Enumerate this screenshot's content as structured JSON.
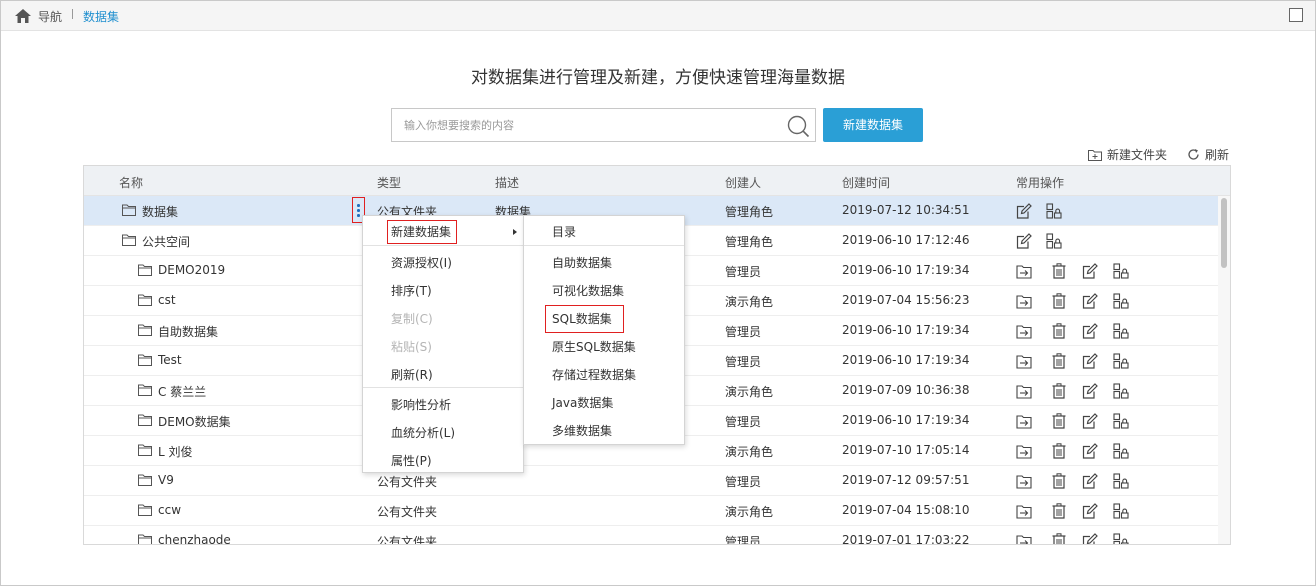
{
  "breadcrumb": {
    "home_label": "导航",
    "current": "数据集"
  },
  "headline": "对数据集进行管理及新建，方便快速管理海量数据",
  "search": {
    "placeholder": "输入你想要搜索的内容",
    "value": ""
  },
  "new_dataset_button": "新建数据集",
  "toolbar": {
    "new_folder": "新建文件夹",
    "refresh": "刷新"
  },
  "columns": [
    "名称",
    "类型",
    "描述",
    "创建人",
    "创建时间",
    "常用操作"
  ],
  "rows": [
    {
      "name": "数据集",
      "type": "公有文件夹",
      "desc": "数据集",
      "creator": "管理角色",
      "time": "2019-07-12 10:34:51",
      "level": 0,
      "selected": true
    },
    {
      "name": "公共空间",
      "type": "",
      "desc": "",
      "creator": "管理角色",
      "time": "2019-06-10 17:12:46",
      "level": 0
    },
    {
      "name": "DEMO2019",
      "type": "",
      "desc": "",
      "creator": "管理员",
      "time": "2019-06-10 17:19:34",
      "level": 1
    },
    {
      "name": "cst",
      "type": "",
      "desc": "",
      "creator": "演示角色",
      "time": "2019-07-04 15:56:23",
      "level": 1
    },
    {
      "name": "自助数据集",
      "type": "",
      "desc": "",
      "creator": "管理员",
      "time": "2019-06-10 17:19:34",
      "level": 1
    },
    {
      "name": "Test",
      "type": "",
      "desc": "",
      "creator": "管理员",
      "time": "2019-06-10 17:19:34",
      "level": 1
    },
    {
      "name": "C 蔡兰兰",
      "type": "",
      "desc": "",
      "creator": "演示角色",
      "time": "2019-07-09 10:36:38",
      "level": 1
    },
    {
      "name": "DEMO数据集",
      "type": "",
      "desc": "",
      "creator": "管理员",
      "time": "2019-06-10 17:19:34",
      "level": 1
    },
    {
      "name": "L 刘俊",
      "type": "",
      "desc": "",
      "creator": "演示角色",
      "time": "2019-07-10 17:05:14",
      "level": 1
    },
    {
      "name": "V9",
      "type": "公有文件夹",
      "desc": "",
      "creator": "管理员",
      "time": "2019-07-12 09:57:51",
      "level": 1
    },
    {
      "name": "ccw",
      "type": "公有文件夹",
      "desc": "",
      "creator": "演示角色",
      "time": "2019-07-04 15:08:10",
      "level": 1
    },
    {
      "name": "chenzhaode",
      "type": "公有文件夹",
      "desc": "",
      "creator": "管理员",
      "time": "2019-07-01 17:03:22",
      "level": 1
    }
  ],
  "context_menu": [
    {
      "label": "新建数据集",
      "has_submenu": true
    },
    {
      "label": "资源授权(I)"
    },
    {
      "label": "排序(T)"
    },
    {
      "label": "复制(C)",
      "disabled": true
    },
    {
      "label": "粘贴(S)",
      "disabled": true
    },
    {
      "label": "刷新(R)"
    },
    {
      "label": "影响性分析"
    },
    {
      "label": "血统分析(L)"
    },
    {
      "label": "属性(P)"
    }
  ],
  "submenu": [
    {
      "label": "目录"
    },
    {
      "label": "自助数据集"
    },
    {
      "label": "可视化数据集"
    },
    {
      "label": "SQL数据集"
    },
    {
      "label": "原生SQL数据集"
    },
    {
      "label": "存储过程数据集"
    },
    {
      "label": "Java数据集"
    },
    {
      "label": "多维数据集"
    }
  ],
  "colors": {
    "accent": "#2a9fd6",
    "link": "#1f8fcf",
    "selected_row": "#dbe8f7",
    "highlight": "#e02020"
  }
}
